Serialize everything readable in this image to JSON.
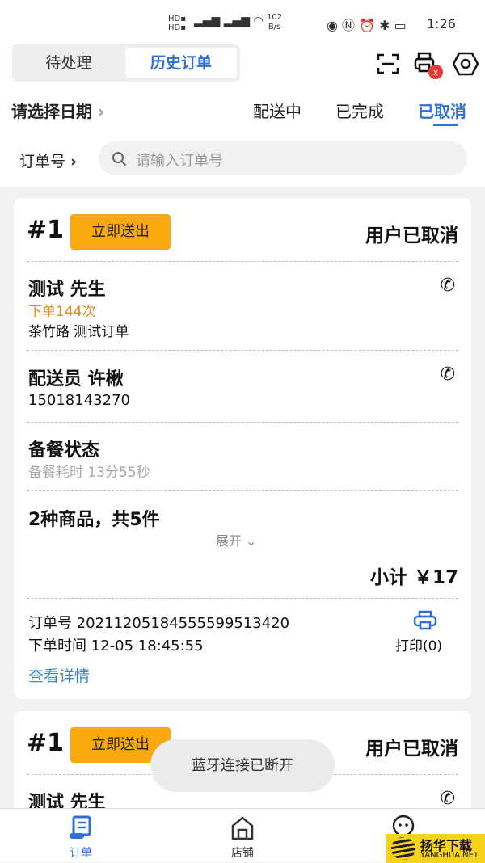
{
  "status_bar": {
    "network_speed": "102",
    "network_unit": "B/s",
    "time": "1:26"
  },
  "header": {
    "tabs": [
      {
        "label": "待处理",
        "active": false
      },
      {
        "label": "历史订单",
        "active": true
      }
    ],
    "icons": [
      "scan-icon",
      "printer-icon",
      "settings-icon"
    ]
  },
  "filters": {
    "date_label": "请选择日期",
    "status_tabs": [
      {
        "label": "配送中",
        "active": false
      },
      {
        "label": "已完成",
        "active": false
      },
      {
        "label": "已取消",
        "active": true
      }
    ]
  },
  "search": {
    "label": "订单号",
    "placeholder": "请输入订单号"
  },
  "orders": [
    {
      "number": "#1",
      "action": "立即送出",
      "status": "用户已取消",
      "customer": "测试 先生",
      "order_count": "下单144次",
      "address": "茶竹路 测试订单",
      "courier": "配送员 许楸",
      "courier_phone": "15018143270",
      "prep_title": "备餐状态",
      "prep_time": "备餐耗时 13分55秒",
      "goods": "2种商品，共5件",
      "expand": "展开",
      "subtotal": "小计 ￥17",
      "order_no": "订单号 20211205184555599513420",
      "order_time": "下单时间 12-05 18:45:55",
      "print": "打印(0)",
      "details": "查看详情"
    },
    {
      "number": "#1",
      "action": "立即送出",
      "status": "用户已取消",
      "customer": "测试 先生"
    }
  ],
  "toast": "蓝牙连接已断开",
  "bottom_nav": [
    {
      "label": "订单",
      "active": true
    },
    {
      "label": "店铺",
      "active": false
    }
  ],
  "watermark": {
    "name": "扬华下载",
    "url": "YANGHUA.NET"
  },
  "colors": {
    "accent": "#2f6fd6",
    "orange_button": "#f9a80e",
    "order_count": "#e8891a",
    "badge": "#e53935"
  }
}
